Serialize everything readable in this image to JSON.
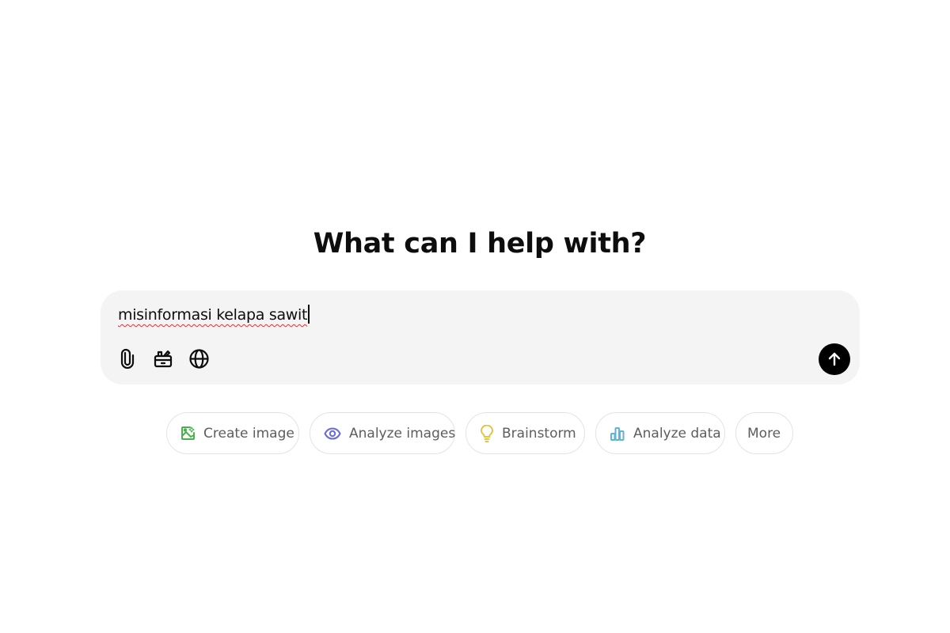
{
  "heading": "What can I help with?",
  "composer": {
    "value": "misinformasi kelapa sawit",
    "tools": [
      {
        "name": "attach-icon",
        "label": "Attach files"
      },
      {
        "name": "toolbox-icon",
        "label": "Tools"
      },
      {
        "name": "globe-icon",
        "label": "Search the web"
      }
    ],
    "send_label": "Send"
  },
  "suggestions": [
    {
      "label": "Create image",
      "icon": "image-icon",
      "color": "#4caf50"
    },
    {
      "label": "Analyze images",
      "icon": "eye-icon",
      "color": "#6b6bd6"
    },
    {
      "label": "Brainstorm",
      "icon": "lightbulb-icon",
      "color": "#e2c541"
    },
    {
      "label": "Analyze data",
      "icon": "bar-chart-icon",
      "color": "#5bb5d6"
    },
    {
      "label": "More",
      "icon": null,
      "color": null
    }
  ]
}
